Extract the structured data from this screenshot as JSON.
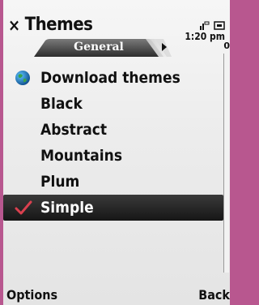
{
  "header": {
    "title": "Themes",
    "tab_label": "General",
    "time": "1:20 pm",
    "side_indicator": "0"
  },
  "list": {
    "items": [
      {
        "label": "Download themes",
        "icon": "globe-icon"
      },
      {
        "label": "Black"
      },
      {
        "label": "Abstract"
      },
      {
        "label": "Mountains"
      },
      {
        "label": "Plum"
      },
      {
        "label": "Simple",
        "selected": true,
        "icon": "checkmark-icon"
      }
    ]
  },
  "softkeys": {
    "left": "Options",
    "right": "Back"
  },
  "colors": {
    "frame": "#b8578f",
    "selection": "#1f1f1f",
    "check": "#d9404f"
  }
}
